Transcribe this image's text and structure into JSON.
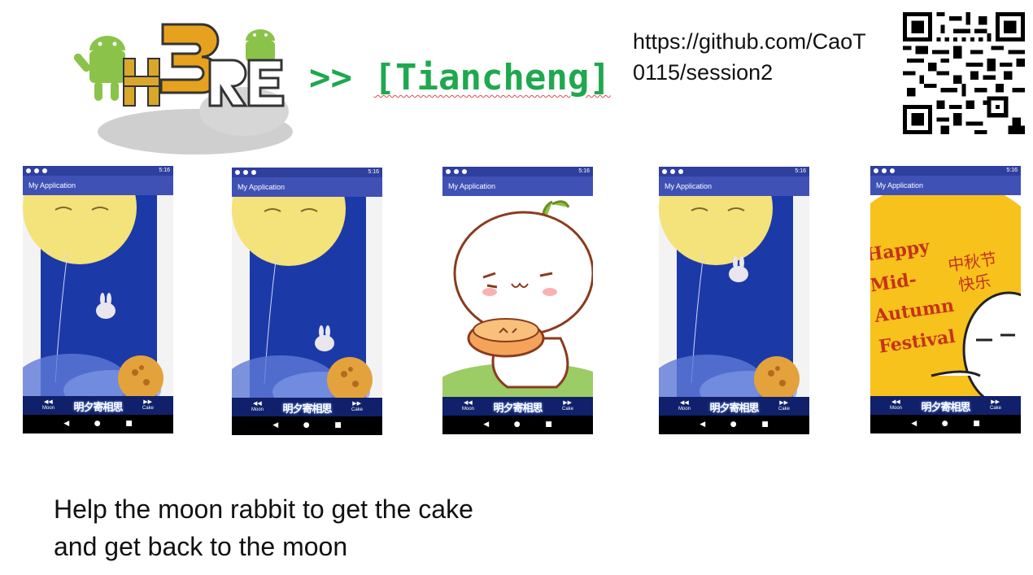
{
  "header": {
    "breadcrumb_prefix": ">>",
    "breadcrumb_name": "[Tiancheng]",
    "repo_url": "https://github.com/CaoT0115/session2"
  },
  "phones": [
    {
      "app_title": "My Application",
      "time": "5:16",
      "left_label": "Moon",
      "right_label": "Cake",
      "banner": "明夕寄相思",
      "scene": "moon-rabbit-start"
    },
    {
      "app_title": "My Application",
      "time": "5:16",
      "left_label": "Moon",
      "right_label": "Cake",
      "banner": "明夕寄相思",
      "scene": "moon-rabbit-mid"
    },
    {
      "app_title": "My Application",
      "time": "5:16",
      "left_label": "Moon",
      "right_label": "Cake",
      "banner": "明夕寄相思",
      "scene": "mooncake-character"
    },
    {
      "app_title": "My Application",
      "time": "5:16",
      "left_label": "Moon",
      "right_label": "Cake",
      "banner": "明夕寄相思",
      "scene": "moon-rabbit-return"
    },
    {
      "app_title": "My Application",
      "time": "5:16",
      "left_label": "Moon",
      "right_label": "Cake",
      "banner": "明夕寄相思",
      "scene": "festival-greeting",
      "greeting_en": "Happy Mid-Autumn Festival",
      "greeting_cn_1": "中秋节",
      "greeting_cn_2": "快乐"
    }
  ],
  "nav_icons": [
    "back-icon",
    "home-icon",
    "recents-icon"
  ],
  "caption": {
    "line1": "Help the moon rabbit to get the cake",
    "line2": "and get back to the moon"
  },
  "colors": {
    "accent_green": "#1fa84f",
    "appbar": "#3f51b5",
    "statusbar": "#2f3f9e",
    "night_sky": "#1b3aa8",
    "festival_yellow": "#f7c21b"
  }
}
